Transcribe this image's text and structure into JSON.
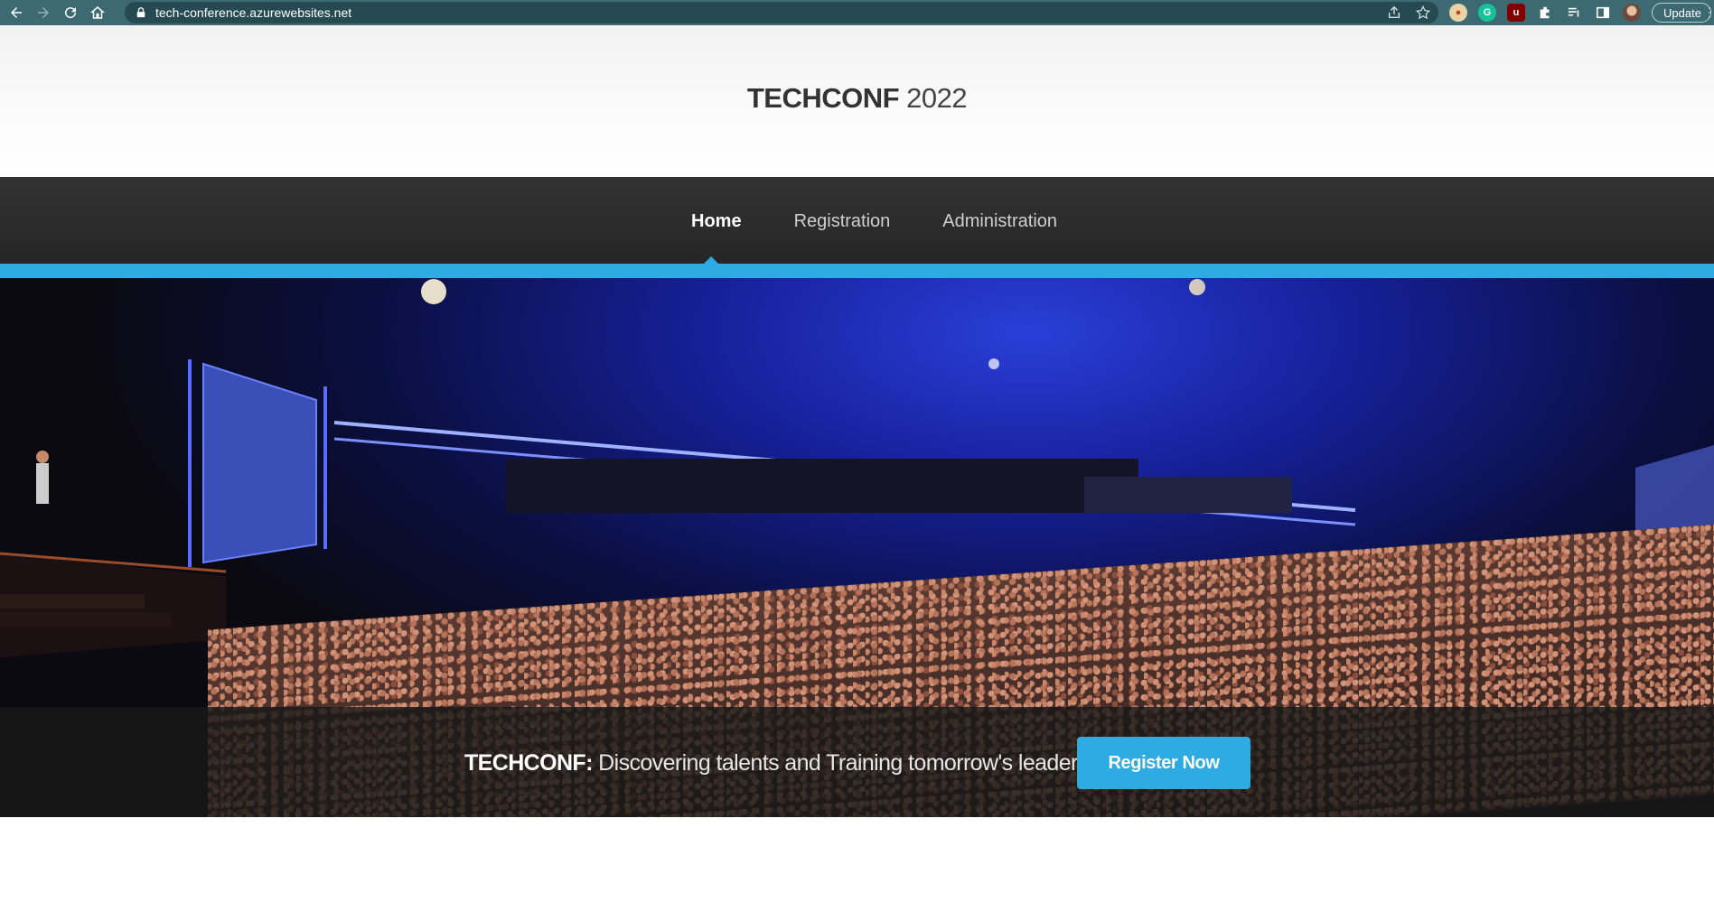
{
  "browser": {
    "url": "tech-conference.azurewebsites.net",
    "update_label": "Update",
    "icons": [
      "back-icon",
      "forward-icon",
      "reload-icon",
      "home-icon",
      "lock-icon",
      "share-icon",
      "star-icon",
      "extension-icon",
      "reading-list-icon",
      "side-panel-icon",
      "profile-avatar"
    ]
  },
  "header": {
    "brand_bold": "TECHCONF",
    "brand_year": " 2022"
  },
  "nav": {
    "items": [
      {
        "label": "Home",
        "active": true
      },
      {
        "label": "Registration",
        "active": false
      },
      {
        "label": "Administration",
        "active": false
      }
    ]
  },
  "hero": {
    "caption_bold": "TECHCONF:",
    "caption_text": " Discovering talents and Training tomorrow's leaders",
    "cta_label": "Register Now"
  },
  "colors": {
    "accent": "#2eabe2",
    "navbar": "#2b2b2b",
    "chrome": "#3d6972"
  }
}
